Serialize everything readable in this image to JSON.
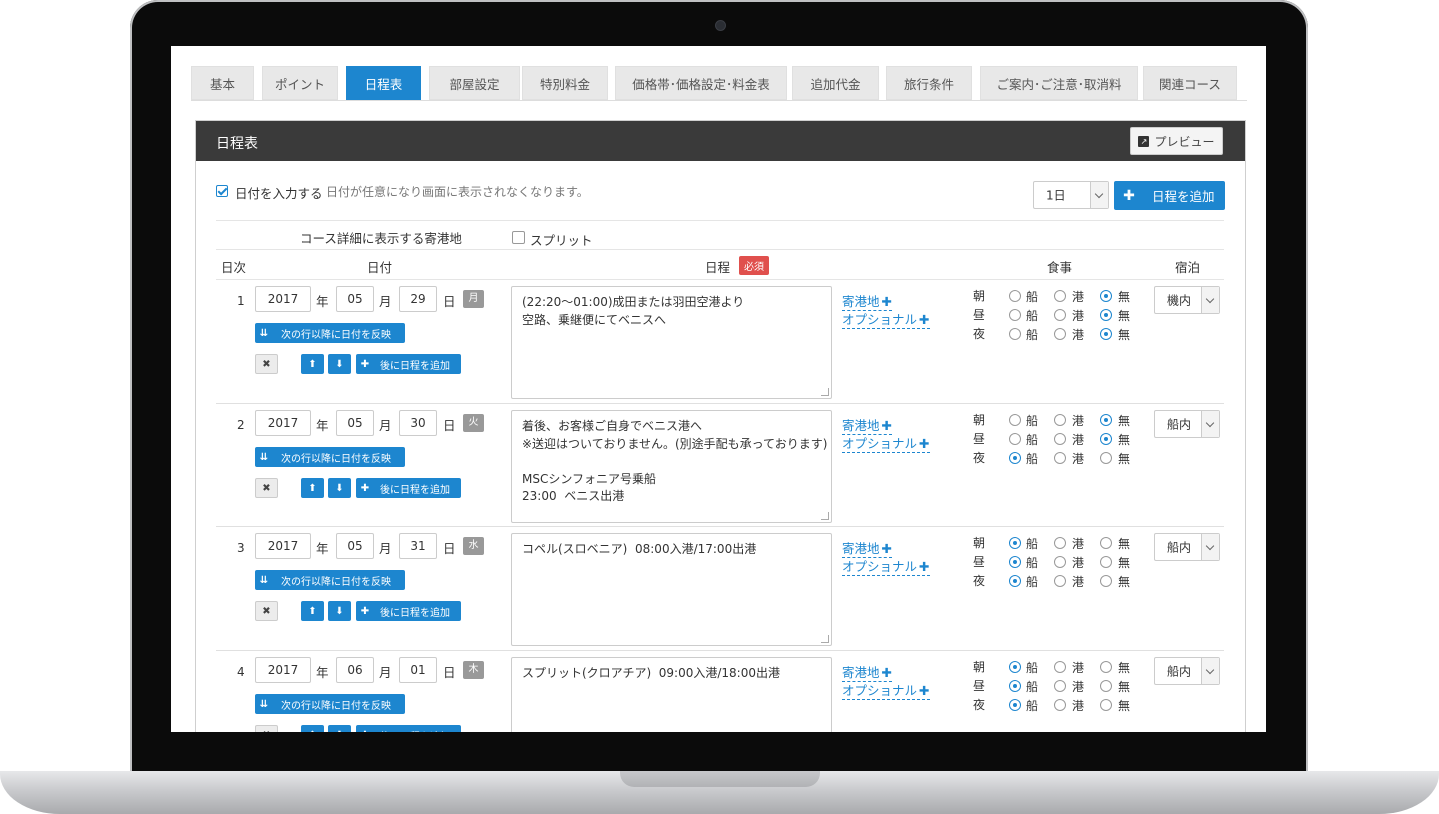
{
  "tabs": [
    {
      "label": "基本",
      "active": false
    },
    {
      "label": "ポイント",
      "active": false
    },
    {
      "label": "日程表",
      "active": true
    },
    {
      "label": "部屋設定",
      "active": false
    },
    {
      "label": "特別料金",
      "active": false
    },
    {
      "label": "価格帯･価格設定･料金表",
      "active": false
    },
    {
      "label": "追加代金",
      "active": false
    },
    {
      "label": "旅行条件",
      "active": false
    },
    {
      "label": "ご案内･ご注意･取消料",
      "active": false
    },
    {
      "label": "関連コース",
      "active": false
    }
  ],
  "panel": {
    "title": "日程表",
    "preview_label": "プレビュー"
  },
  "options": {
    "date_input_label": "日付を入力する",
    "date_input_checked": true,
    "date_input_note": "日付が任意になり画面に表示されなくなります。",
    "day_select_value": "1日",
    "add_schedule_label": "日程を追加",
    "port_display_label": "コース詳細に表示する寄港地",
    "split_label": "スプリット",
    "split_checked": false
  },
  "columns": {
    "day": "日次",
    "date": "日付",
    "schedule": "日程",
    "required_badge": "必須",
    "meals": "食事",
    "lodging": "宿泊"
  },
  "labels": {
    "year_unit": "年",
    "month_unit": "月",
    "day_unit": "日",
    "reflect_label": "次の行以降に日付を反映",
    "delete_icon": "close-icon",
    "up_icon": "arrow-up-icon",
    "down_icon": "arrow-down-icon",
    "add_after_label": "後に日程を追加",
    "port_link": "寄港地",
    "optional_link": "オプショナル",
    "meal_breakfast": "朝",
    "meal_lunch": "昼",
    "meal_dinner": "夜",
    "opt_ship": "船",
    "opt_port": "港",
    "opt_none": "無"
  },
  "days": [
    {
      "num": "1",
      "year": "2017",
      "month": "05",
      "day": "29",
      "dow": "月",
      "schedule": [
        "(22:20～01:00)成田または羽田空港より",
        "空路、乗継便にてベニスへ"
      ],
      "meals": {
        "breakfast": "none",
        "lunch": "none",
        "dinner": "none"
      },
      "lodging": "機内"
    },
    {
      "num": "2",
      "year": "2017",
      "month": "05",
      "day": "30",
      "dow": "火",
      "schedule": [
        "着後、お客様ご自身でベニス港へ",
        "※送迎はついておりません。(別途手配も承っております)",
        "",
        "MSCシンフォニア号乗船",
        "23:00  ベニス出港"
      ],
      "meals": {
        "breakfast": "none",
        "lunch": "none",
        "dinner": "ship"
      },
      "lodging": "船内"
    },
    {
      "num": "3",
      "year": "2017",
      "month": "05",
      "day": "31",
      "dow": "水",
      "schedule": [
        "コペル(スロベニア)  08:00入港/17:00出港"
      ],
      "meals": {
        "breakfast": "ship",
        "lunch": "ship",
        "dinner": "ship"
      },
      "lodging": "船内"
    },
    {
      "num": "4",
      "year": "2017",
      "month": "06",
      "day": "01",
      "dow": "木",
      "schedule": [
        "スプリット(クロアチア)  09:00入港/18:00出港"
      ],
      "meals": {
        "breakfast": "ship",
        "lunch": "ship",
        "dinner": "ship"
      },
      "lodging": "船内"
    }
  ]
}
